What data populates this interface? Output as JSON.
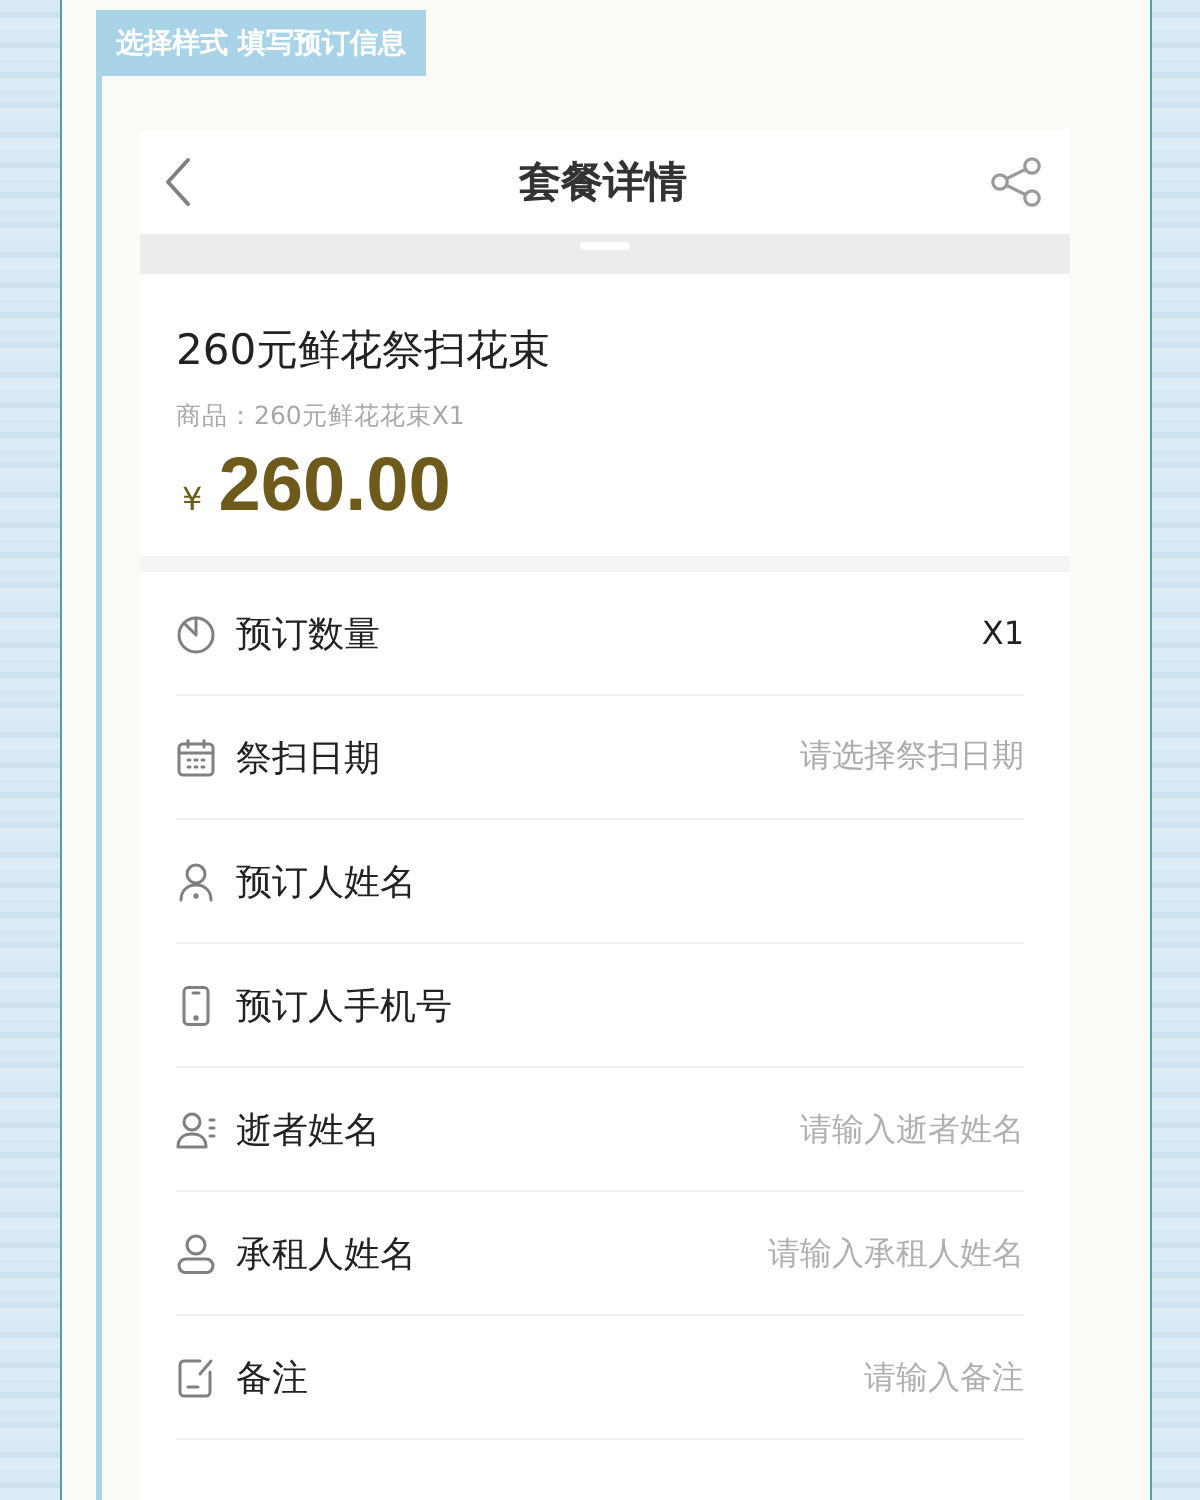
{
  "banner": {
    "label": "选择样式 填写预订信息"
  },
  "header": {
    "title": "套餐详情"
  },
  "product": {
    "title": "260元鲜花祭扫花束",
    "subtitle": "商品：260元鲜花花束X1",
    "currency": "¥",
    "price": "260.00"
  },
  "form": {
    "rows": [
      {
        "kind": "value",
        "label": "预订数量",
        "value": "X1"
      },
      {
        "kind": "select",
        "label": "祭扫日期",
        "placeholder": "请选择祭扫日期"
      },
      {
        "label": "预订人姓名"
      },
      {
        "label": "预订人手机号"
      },
      {
        "kind": "input",
        "label": "逝者姓名",
        "placeholder": "请输入逝者姓名"
      },
      {
        "kind": "input",
        "label": "承租人姓名",
        "placeholder": "请输入承租人姓名"
      },
      {
        "kind": "input",
        "label": "备注",
        "placeholder": "请输入备注"
      }
    ]
  }
}
